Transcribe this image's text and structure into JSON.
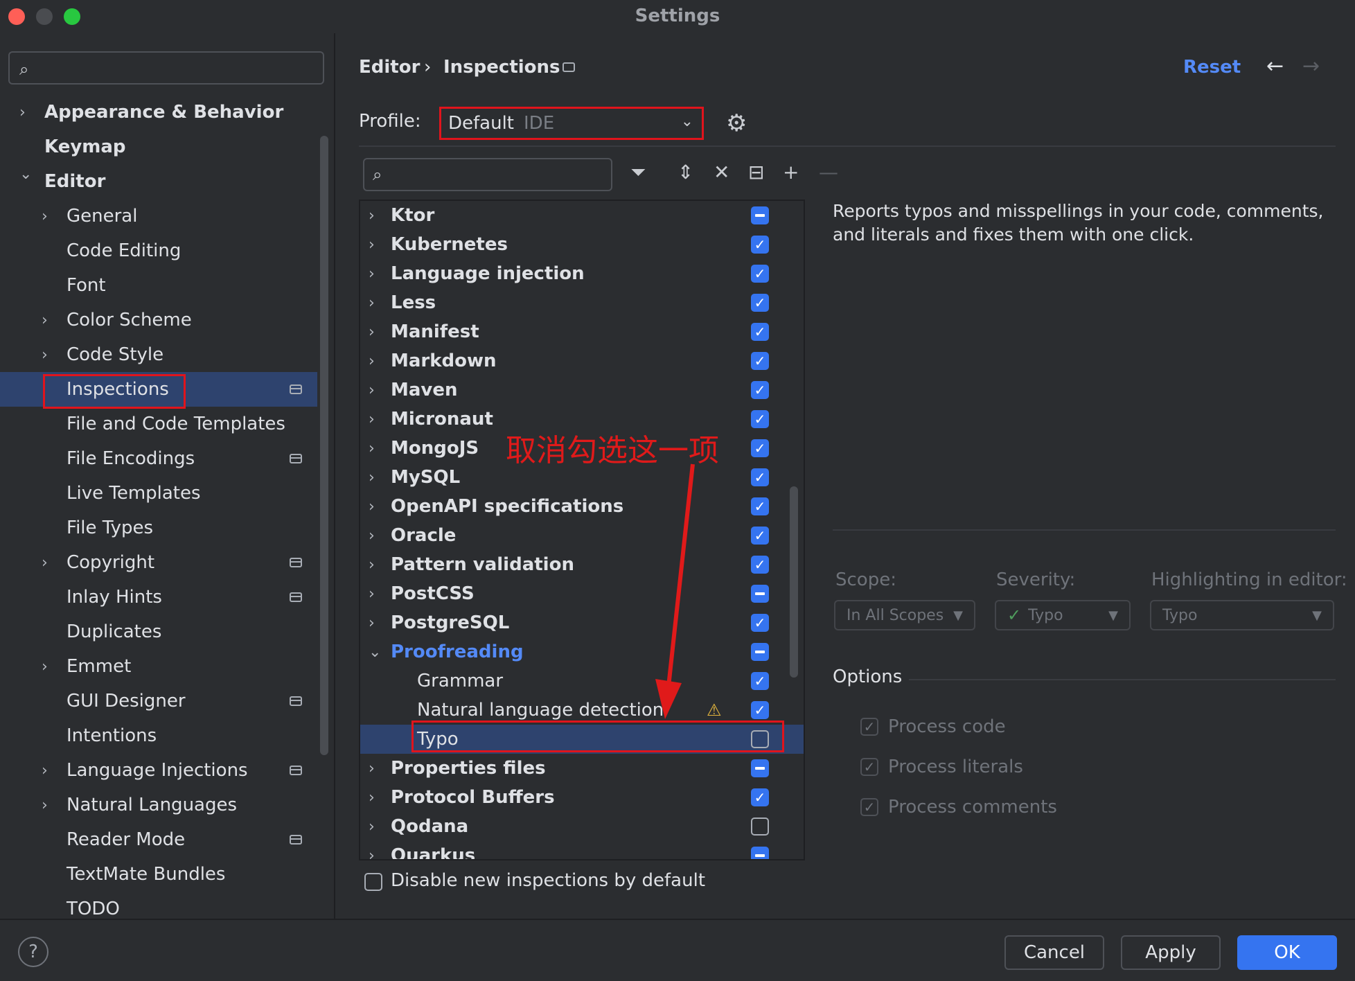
{
  "window": {
    "title": "Settings"
  },
  "sidebar": {
    "search_placeholder": "",
    "items": [
      {
        "label": "Appearance & Behavior",
        "bold": true,
        "chevron": "right"
      },
      {
        "label": "Keymap",
        "bold": true,
        "chevron": ""
      },
      {
        "label": "Editor",
        "bold": true,
        "chevron": "down"
      },
      {
        "label": "General",
        "chevron": "right"
      },
      {
        "label": "Code Editing",
        "chevron": ""
      },
      {
        "label": "Font",
        "chevron": ""
      },
      {
        "label": "Color Scheme",
        "chevron": "right"
      },
      {
        "label": "Code Style",
        "chevron": "right"
      },
      {
        "label": "Inspections",
        "chevron": "",
        "selected": true,
        "project_icon": true
      },
      {
        "label": "File and Code Templates",
        "chevron": ""
      },
      {
        "label": "File Encodings",
        "chevron": "",
        "project_icon": true
      },
      {
        "label": "Live Templates",
        "chevron": ""
      },
      {
        "label": "File Types",
        "chevron": ""
      },
      {
        "label": "Copyright",
        "chevron": "right",
        "project_icon": true
      },
      {
        "label": "Inlay Hints",
        "chevron": "",
        "project_icon": true
      },
      {
        "label": "Duplicates",
        "chevron": ""
      },
      {
        "label": "Emmet",
        "chevron": "right"
      },
      {
        "label": "GUI Designer",
        "chevron": "",
        "project_icon": true
      },
      {
        "label": "Intentions",
        "chevron": ""
      },
      {
        "label": "Language Injections",
        "chevron": "right",
        "project_icon": true
      },
      {
        "label": "Natural Languages",
        "chevron": "right"
      },
      {
        "label": "Reader Mode",
        "chevron": "",
        "project_icon": true
      },
      {
        "label": "TextMate Bundles",
        "chevron": ""
      },
      {
        "label": "TODO",
        "chevron": ""
      }
    ]
  },
  "header": {
    "breadcrumb_parent": "Editor",
    "breadcrumb_sep": "›",
    "breadcrumb_current": "Inspections",
    "reset_label": "Reset"
  },
  "profile": {
    "label": "Profile:",
    "value": "Default",
    "scope": "IDE"
  },
  "tree": {
    "search_placeholder": "",
    "rows": [
      {
        "label": "Ktor",
        "level": 0,
        "chevron": "right",
        "state": "partial"
      },
      {
        "label": "Kubernetes",
        "level": 0,
        "chevron": "right",
        "state": "checked"
      },
      {
        "label": "Language injection",
        "level": 0,
        "chevron": "right",
        "state": "checked"
      },
      {
        "label": "Less",
        "level": 0,
        "chevron": "right",
        "state": "checked"
      },
      {
        "label": "Manifest",
        "level": 0,
        "chevron": "right",
        "state": "checked"
      },
      {
        "label": "Markdown",
        "level": 0,
        "chevron": "right",
        "state": "checked"
      },
      {
        "label": "Maven",
        "level": 0,
        "chevron": "right",
        "state": "checked"
      },
      {
        "label": "Micronaut",
        "level": 0,
        "chevron": "right",
        "state": "checked"
      },
      {
        "label": "MongoJS",
        "level": 0,
        "chevron": "right",
        "state": "checked"
      },
      {
        "label": "MySQL",
        "level": 0,
        "chevron": "right",
        "state": "checked"
      },
      {
        "label": "OpenAPI specifications",
        "level": 0,
        "chevron": "right",
        "state": "checked"
      },
      {
        "label": "Oracle",
        "level": 0,
        "chevron": "right",
        "state": "checked"
      },
      {
        "label": "Pattern validation",
        "level": 0,
        "chevron": "right",
        "state": "checked"
      },
      {
        "label": "PostCSS",
        "level": 0,
        "chevron": "right",
        "state": "partial"
      },
      {
        "label": "PostgreSQL",
        "level": 0,
        "chevron": "right",
        "state": "checked"
      },
      {
        "label": "Proofreading",
        "level": 0,
        "chevron": "down",
        "state": "partial",
        "highlight": true
      },
      {
        "label": "Grammar",
        "level": 1,
        "chevron": "",
        "state": "checked"
      },
      {
        "label": "Natural language detection",
        "level": 1,
        "chevron": "",
        "state": "checked",
        "warning": true
      },
      {
        "label": "Typo",
        "level": 1,
        "chevron": "",
        "state": "empty",
        "selected": true
      },
      {
        "label": "Properties files",
        "level": 0,
        "chevron": "right",
        "state": "partial"
      },
      {
        "label": "Protocol Buffers",
        "level": 0,
        "chevron": "right",
        "state": "checked"
      },
      {
        "label": "Qodana",
        "level": 0,
        "chevron": "right",
        "state": "empty"
      },
      {
        "label": "Quarkus",
        "level": 0,
        "chevron": "right",
        "state": "partial"
      }
    ],
    "disable_label": "Disable new inspections by default"
  },
  "annotation": "取消勾选这一项",
  "details": {
    "description": "Reports typos and misspellings in your code, comments, and literals and fixes them with one click.",
    "scope_label": "Scope:",
    "scope_value": "In All Scopes",
    "severity_label": "Severity:",
    "severity_value": "Typo",
    "highlight_label": "Highlighting in editor:",
    "highlight_value": "Typo",
    "options_label": "Options",
    "options": [
      "Process code",
      "Process literals",
      "Process comments"
    ]
  },
  "footer": {
    "help": "?",
    "cancel": "Cancel",
    "apply": "Apply",
    "ok": "OK"
  },
  "colors": {
    "accent": "#3574f0",
    "selection": "#2e436e",
    "highlight_box": "#e0141c",
    "link": "#548af7"
  }
}
